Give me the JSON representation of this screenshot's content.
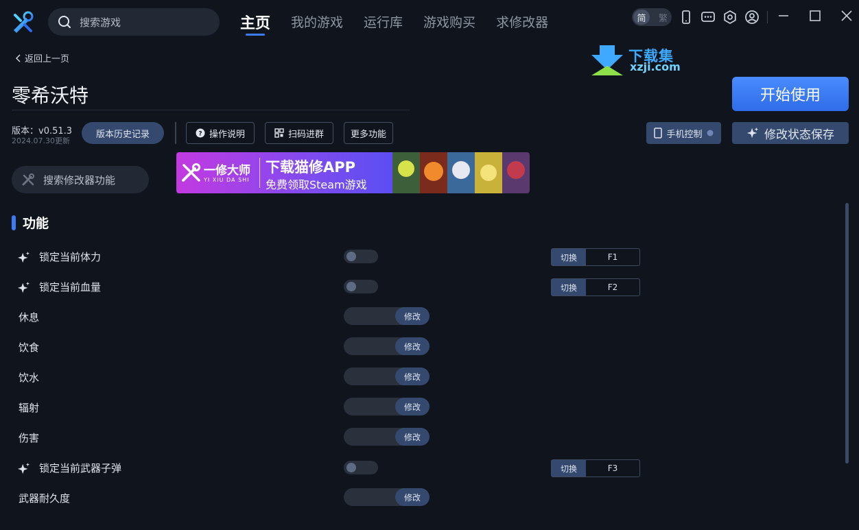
{
  "top": {
    "search_placeholder": "搜索游戏",
    "nav": [
      "主页",
      "我的游戏",
      "运行库",
      "游戏购买",
      "求修改器"
    ],
    "active_nav_index": 0,
    "lang_on": "简",
    "lang_off": "繁",
    "icons": [
      "phone-icon",
      "chat-icon",
      "settings-icon",
      "user-icon",
      "minimize-icon",
      "maximize-icon",
      "close-icon"
    ]
  },
  "header": {
    "back_label": "返回上一页",
    "brand_cn": "下载集",
    "brand_en": "xzji.com",
    "game_title": "零希沃特",
    "start_label": "开始使用",
    "version": "版本：v0.51.3",
    "version_date": "2024.07.30更新",
    "history_label": "版本历史记录",
    "guide_label": "操作说明",
    "qr_label": "扫码进群",
    "more_label": "更多功能",
    "phone_label": "手机控制",
    "save_label": "修改状态保存"
  },
  "feature_search_placeholder": "搜索修改器功能",
  "banner": {
    "brand_cn": "一修大师",
    "brand_en": "YI XIU DA SHI",
    "headline": "下载猫修APP",
    "subline": "免费领取Steam游戏"
  },
  "section_title": "功能",
  "switch_label": "切换",
  "modify_label": "修改",
  "features": [
    {
      "label": "锁定当前体力",
      "kind": "toggle",
      "starred": true,
      "hotkey": "F1",
      "on": false
    },
    {
      "label": "锁定当前血量",
      "kind": "toggle",
      "starred": true,
      "hotkey": "F2",
      "on": false
    },
    {
      "label": "休息",
      "kind": "modify",
      "starred": false
    },
    {
      "label": "饮食",
      "kind": "modify",
      "starred": false
    },
    {
      "label": "饮水",
      "kind": "modify",
      "starred": false
    },
    {
      "label": "辐射",
      "kind": "modify",
      "starred": false
    },
    {
      "label": "伤害",
      "kind": "modify",
      "starred": false
    },
    {
      "label": "锁定当前武器子弹",
      "kind": "toggle",
      "starred": true,
      "hotkey": "F3",
      "on": false
    },
    {
      "label": "武器耐久度",
      "kind": "modify",
      "starred": false
    }
  ],
  "colors": {
    "background": "#0f141d",
    "accent": "#3d7bf5",
    "button_fill": "#34496d"
  }
}
